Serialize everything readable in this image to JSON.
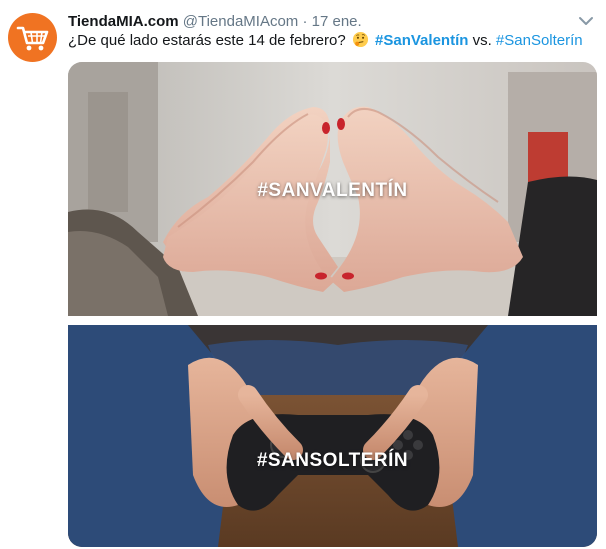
{
  "tweet": {
    "author_name": "TiendaMIA.com",
    "author_handle": "@TiendaMIAcom",
    "separator": "·",
    "date": "17 ene.",
    "text_prefix": "¿De qué lado estarás este 14 de febrero?",
    "hashtag_1": "#SanValentín",
    "text_connector": "vs.",
    "hashtag_2": "#SanSolterín",
    "emoji": "thinking-face-icon",
    "avatar_icon": "shopping-cart-icon"
  },
  "media": {
    "top_caption": "#SANVALENTÍN",
    "bottom_caption": "#SANSOLTERÍN"
  },
  "colors": {
    "brand_orange": "#f07322",
    "link_blue": "#1b95e0",
    "meta_gray": "#657786"
  }
}
